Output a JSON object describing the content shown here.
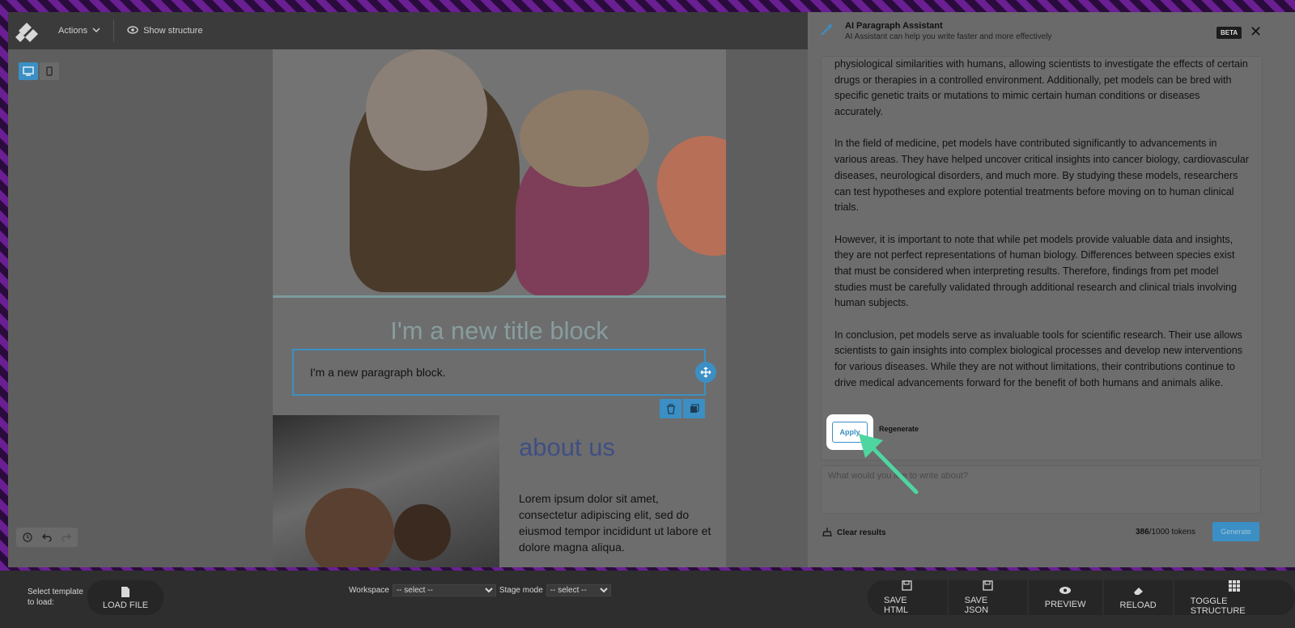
{
  "topbar": {
    "actions_label": "Actions",
    "show_structure_label": "Show structure"
  },
  "email": {
    "title_block": "I'm a new title block",
    "paragraph_block": "I'm a new paragraph block.",
    "about_title": "about us",
    "about_text": "Lorem ipsum dolor sit amet, consectetur adipiscing elit, sed do eiusmod tempor incididunt ut labore et dolore magna aliqua."
  },
  "panel": {
    "title": "AI Paragraph Assistant",
    "subtitle": "AI Assistant can help you write faster and more effectively",
    "badge": "BETA",
    "paragraphs": [
      "physiological similarities with humans, allowing scientists to investigate the effects of certain drugs or therapies in a controlled environment. Additionally, pet models can be bred with specific genetic traits or mutations to mimic certain human conditions or diseases accurately.",
      "In the field of medicine, pet models have contributed significantly to advancements in various areas. They have helped uncover critical insights into cancer biology, cardiovascular diseases, neurological disorders, and much more. By studying these models, researchers can test hypotheses and explore potential treatments before moving on to human clinical trials.",
      "However, it is important to note that while pet models provide valuable data and insights, they are not perfect representations of human biology. Differences between species exist that must be considered when interpreting results. Therefore, findings from pet model studies must be carefully validated through additional research and clinical trials involving human subjects.",
      "In conclusion, pet models serve as invaluable tools for scientific research. Their use allows scientists to gain insights into complex biological processes and develop new interventions for various diseases. While they are not without limitations, their contributions continue to drive medical advancements forward for the benefit of both humans and animals alike."
    ],
    "apply_label": "Apply",
    "regenerate_label": "Regenerate",
    "prompt_placeholder": "What would you like to write about?",
    "clear_label": "Clear results",
    "tokens_used": "386",
    "tokens_total": "/1000 tokens",
    "generate_label": "Generate"
  },
  "bottombar": {
    "select_template_label": "Select template to load:",
    "load_file_label": "LOAD FILE",
    "workspace_label": "Workspace",
    "workspace_value": "-- select --",
    "stage_mode_label": "Stage mode",
    "stage_mode_value": "-- select --",
    "save_html_label": "SAVE HTML",
    "save_json_label": "SAVE JSON",
    "preview_label": "PREVIEW",
    "reload_label": "RELOAD",
    "toggle_structure_label": "TOGGLE STRUCTURE"
  },
  "colors": {
    "accent": "#3b8fc4",
    "frame": "#6a1f92",
    "arrow": "#4fd6a0",
    "about_title": "#3f4f84"
  }
}
